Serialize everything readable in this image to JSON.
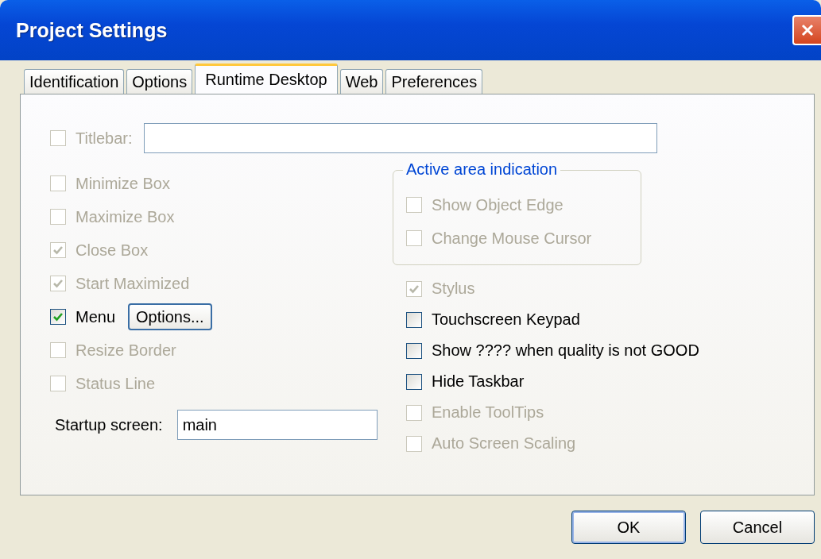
{
  "window": {
    "title": "Project Settings"
  },
  "tabs": [
    {
      "label": "Identification",
      "selected": false
    },
    {
      "label": "Options",
      "selected": false
    },
    {
      "label": "Runtime Desktop",
      "selected": true
    },
    {
      "label": "Web",
      "selected": false
    },
    {
      "label": "Preferences",
      "selected": false
    }
  ],
  "titlebar": {
    "label": "Titlebar:",
    "checked": false,
    "disabled": true
  },
  "left_options": [
    {
      "kind": "checkbox",
      "label": "Minimize Box",
      "checked": false,
      "disabled": true
    },
    {
      "kind": "checkbox",
      "label": "Maximize Box",
      "checked": false,
      "disabled": true
    },
    {
      "kind": "checkbox",
      "label": "Close Box",
      "checked": true,
      "disabled": true
    },
    {
      "kind": "checkbox",
      "label": "Start Maximized",
      "checked": true,
      "disabled": true
    },
    {
      "kind": "checkbox_button",
      "label": "Menu",
      "checked": true,
      "disabled": false,
      "button": "Options..."
    },
    {
      "kind": "checkbox",
      "label": "Resize Border",
      "checked": false,
      "disabled": true
    },
    {
      "kind": "checkbox",
      "label": "Status Line",
      "checked": false,
      "disabled": true
    }
  ],
  "startup_screen": {
    "label": "Startup screen:",
    "value": "main"
  },
  "active_area": {
    "title": "Active area indication",
    "options": [
      {
        "label": "Show Object Edge",
        "checked": false,
        "disabled": true
      },
      {
        "label": "Change Mouse Cursor",
        "checked": false,
        "disabled": true
      }
    ]
  },
  "right_options": [
    {
      "label": "Stylus",
      "checked": true,
      "disabled": true
    },
    {
      "label": "Touchscreen Keypad",
      "checked": false,
      "disabled": false
    },
    {
      "label": "Show ???? when quality is not GOOD",
      "checked": false,
      "disabled": false
    },
    {
      "label": "Hide Taskbar",
      "checked": false,
      "disabled": false
    },
    {
      "label": "Enable ToolTips",
      "checked": false,
      "disabled": true
    },
    {
      "label": "Auto Screen Scaling",
      "checked": false,
      "disabled": true
    }
  ],
  "buttons": [
    {
      "label": "OK",
      "default": true
    },
    {
      "label": "Cancel",
      "default": false
    }
  ]
}
